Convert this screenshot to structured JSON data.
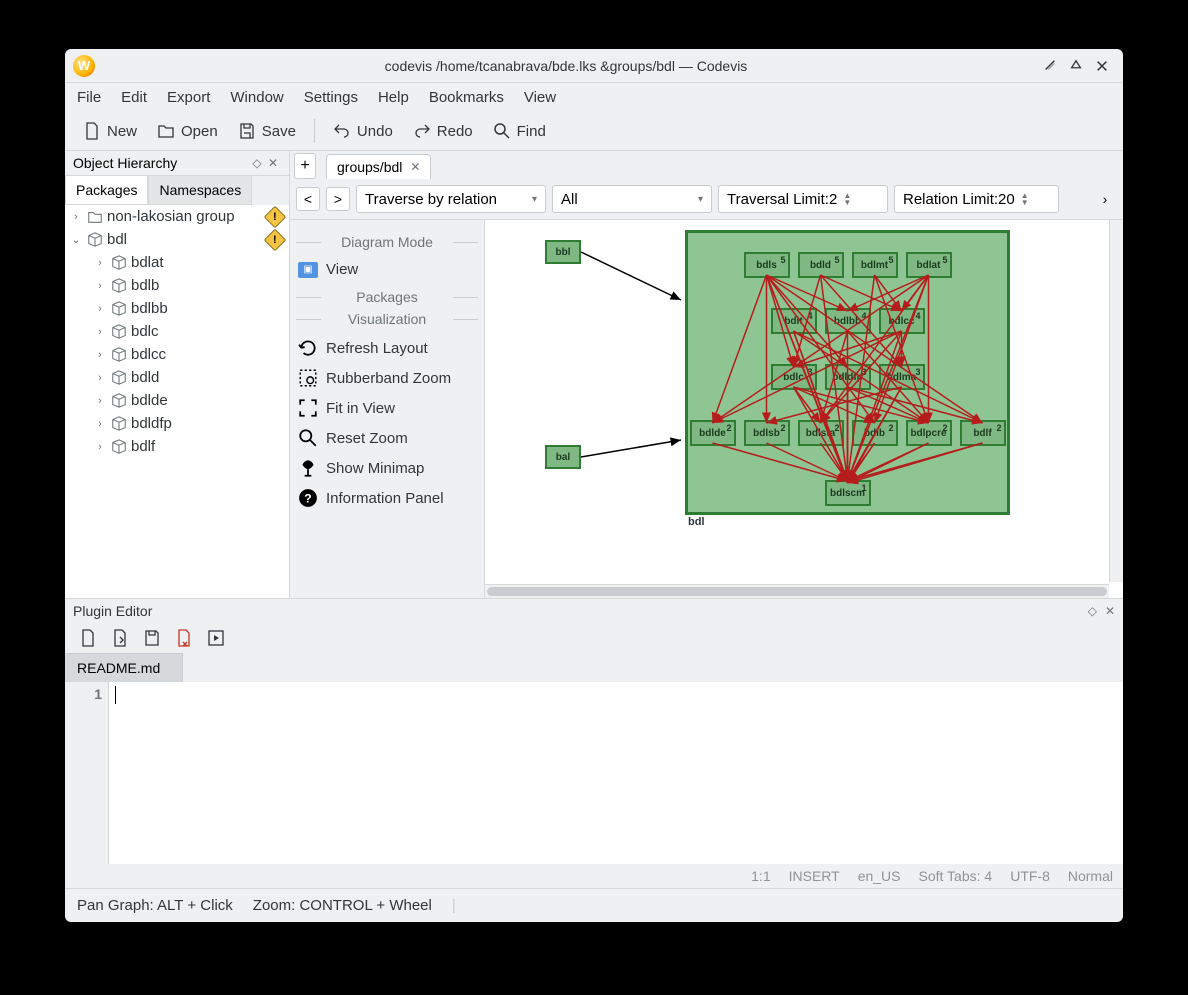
{
  "title": "codevis /home/tcanabrava/bde.lks &groups/bdl — Codevis",
  "menus": [
    "File",
    "Edit",
    "Export",
    "Window",
    "Settings",
    "Help",
    "Bookmarks",
    "View"
  ],
  "toolbar": {
    "new": "New",
    "open": "Open",
    "save": "Save",
    "undo": "Undo",
    "redo": "Redo",
    "find": "Find"
  },
  "left": {
    "title": "Object Hierarchy",
    "tabs": {
      "packages": "Packages",
      "namespaces": "Namespaces"
    },
    "roots": [
      {
        "label": "non-lakosian group",
        "warn": true,
        "icon": "folder"
      },
      {
        "label": "bdl",
        "warn": true,
        "icon": "cube",
        "expanded": true,
        "children": [
          "bdlat",
          "bdlb",
          "bdlbb",
          "bdlc",
          "bdlcc",
          "bdld",
          "bdlde",
          "bdldfp",
          "bdlf"
        ]
      }
    ]
  },
  "tab": {
    "name": "groups/bdl"
  },
  "controls": {
    "traverse": "Traverse by relation",
    "filter": "All",
    "travlimit_label": "Traversal Limit: ",
    "travlimit_val": "2",
    "rellimit_label": "Relation Limit: ",
    "rellimit_val": "20"
  },
  "tools": {
    "s1": "Diagram Mode",
    "view": "View",
    "s2": "Packages",
    "s3": "Visualization",
    "refresh": "Refresh Layout",
    "rubber": "Rubberband Zoom",
    "fit": "Fit in View",
    "reset": "Reset Zoom",
    "minimap": "Show Minimap",
    "info": "Information Panel"
  },
  "diagram": {
    "group_label": "bdl",
    "ext": [
      {
        "name": "bbl"
      },
      {
        "name": "bal"
      }
    ],
    "rows": [
      [
        [
          "bdls",
          5
        ],
        [
          "bdld",
          5
        ],
        [
          "bdlmt",
          5
        ],
        [
          "bdlat",
          5
        ]
      ],
      [
        [
          "bdlt",
          4
        ],
        [
          "bdlbb",
          4
        ],
        [
          "bdlcc",
          4
        ]
      ],
      [
        [
          "bdlc",
          3
        ],
        [
          "bdldfp",
          3
        ],
        [
          "bdlma",
          3
        ]
      ],
      [
        [
          "bdlde",
          2
        ],
        [
          "bdlsb",
          2
        ],
        [
          "bdlsta",
          2
        ],
        [
          "bdlb",
          2
        ],
        [
          "bdlpcre",
          2
        ],
        [
          "bdlf",
          2
        ]
      ],
      [
        [
          "bdlscm",
          1
        ]
      ]
    ]
  },
  "plugin": {
    "title": "Plugin Editor",
    "tab": "README.md",
    "line": "1",
    "status": {
      "pos": "1:1",
      "mode": "INSERT",
      "locale": "en_US",
      "tabs": "Soft Tabs: 4",
      "enc": "UTF-8",
      "normal": "Normal"
    }
  },
  "statusbar": {
    "pan": "Pan Graph: ALT + Click",
    "zoom": "Zoom: CONTROL + Wheel"
  }
}
